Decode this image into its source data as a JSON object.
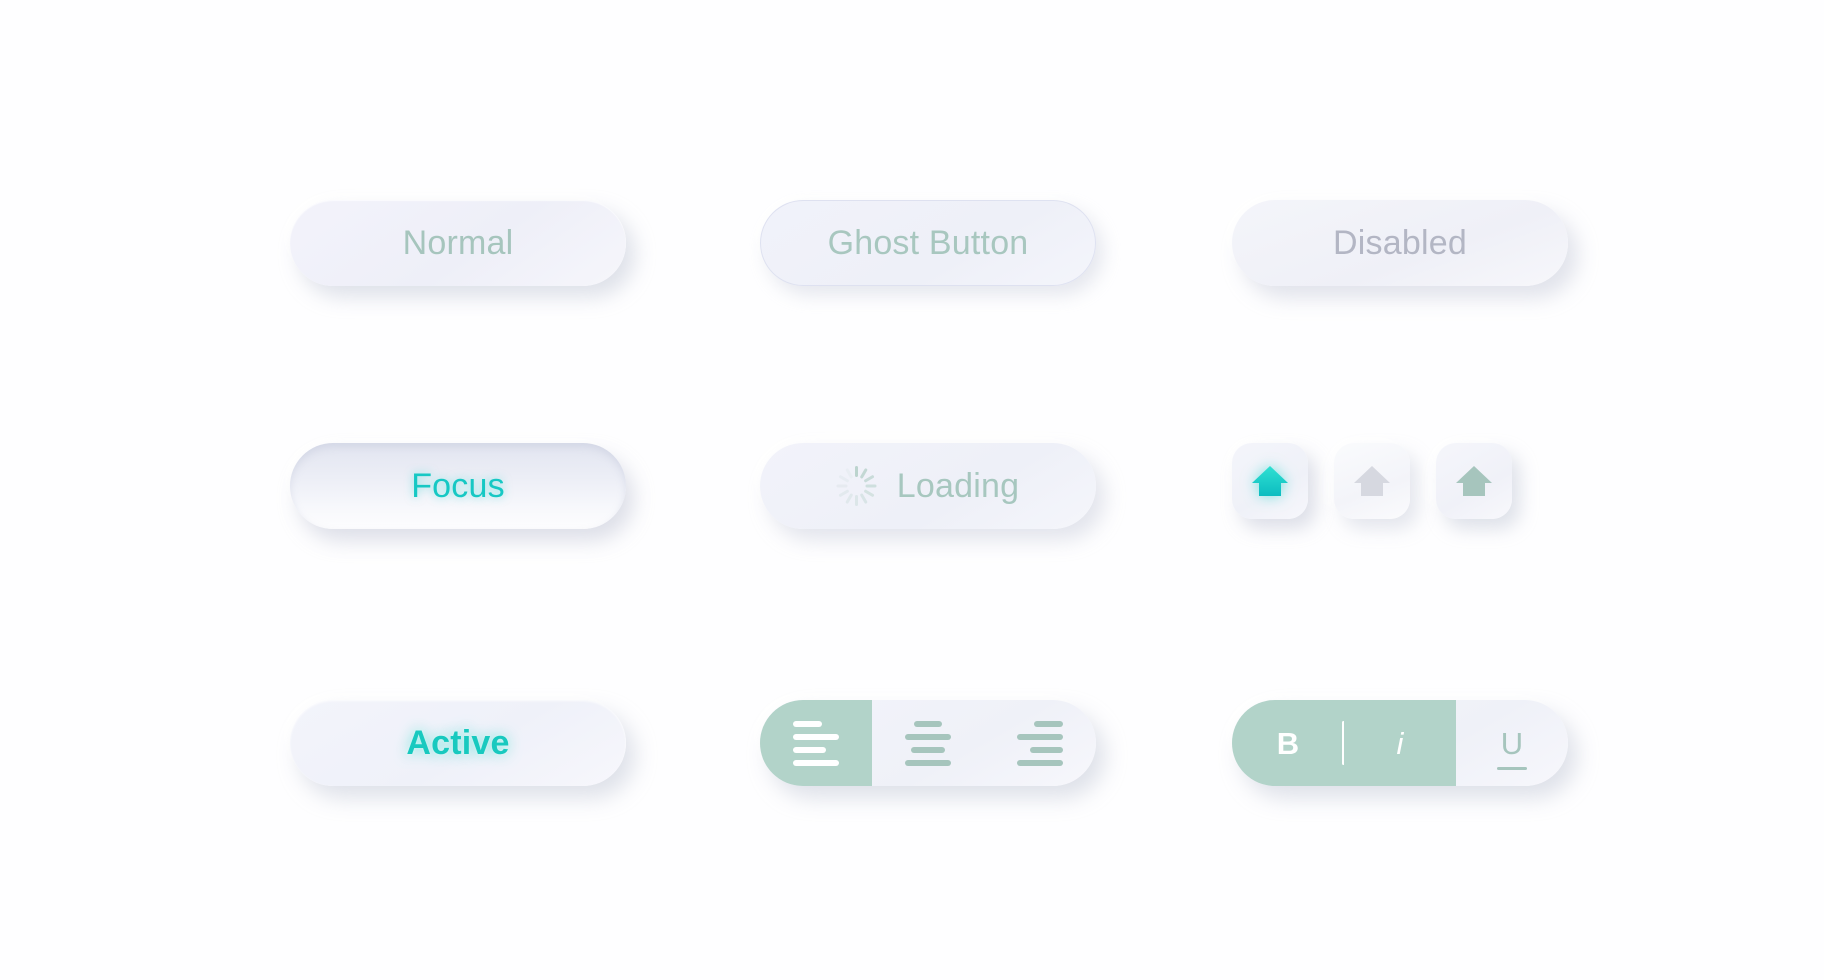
{
  "palette": {
    "background": "#fefeff",
    "surface": "#f1f2f9",
    "text_sage": "#a6c5bd",
    "text_disabled": "#b3b6c4",
    "accent_teal": "#16c8c4",
    "segment_selected": "#b2d3c9",
    "segment_selected_text": "#ffffff"
  },
  "buttons": {
    "normal": {
      "label": "Normal",
      "state": "normal"
    },
    "ghost": {
      "label": "Ghost Button",
      "state": "ghost"
    },
    "disabled": {
      "label": "Disabled",
      "state": "disabled"
    },
    "focus": {
      "label": "Focus",
      "state": "focus"
    },
    "loading": {
      "label": "Loading",
      "state": "loading",
      "spinner_icon": "spinner-icon",
      "spinner_spokes": 12
    },
    "active": {
      "label": "Active",
      "state": "active"
    }
  },
  "icon_buttons": [
    {
      "icon": "home-icon",
      "state": "active",
      "color": "#16c8c4"
    },
    {
      "icon": "home-icon",
      "state": "disabled",
      "color": "#d6d8e0"
    },
    {
      "icon": "home-icon",
      "state": "normal",
      "color": "#a6c5bd"
    }
  ],
  "align_group": {
    "name": "text-alignment-group",
    "segments": [
      {
        "icon": "align-left-icon",
        "label": "Align left",
        "selected": true
      },
      {
        "icon": "align-center-icon",
        "label": "Align center",
        "selected": false
      },
      {
        "icon": "align-right-icon",
        "label": "Align right",
        "selected": false
      }
    ]
  },
  "format_group": {
    "name": "text-format-group",
    "segments": [
      {
        "icon": "bold-icon",
        "label": "B",
        "selected": true
      },
      {
        "icon": "italic-icon",
        "label": "i",
        "selected": true
      },
      {
        "icon": "underline-icon",
        "label": "U",
        "selected": false
      }
    ]
  }
}
